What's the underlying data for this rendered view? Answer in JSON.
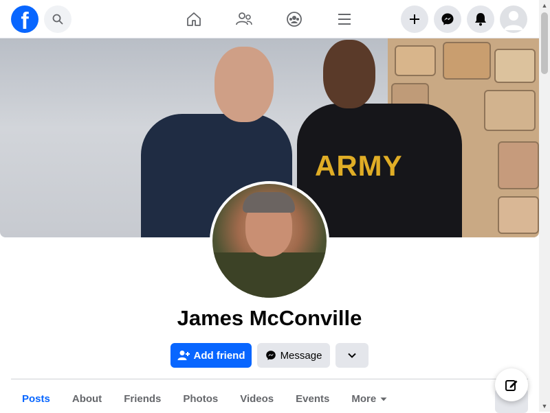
{
  "nav": {
    "logo_letter": "f",
    "icons": [
      "search-icon",
      "home-icon",
      "friends-icon",
      "groups-icon",
      "menu-icon",
      "create-icon",
      "messenger-icon",
      "notifications-icon",
      "account-avatar"
    ]
  },
  "cover": {
    "shirt_text": "ARMY"
  },
  "profile": {
    "name": "James McConville"
  },
  "actions": {
    "add_friend": "Add friend",
    "message": "Message"
  },
  "tabs": [
    {
      "label": "Posts",
      "active": true
    },
    {
      "label": "About"
    },
    {
      "label": "Friends"
    },
    {
      "label": "Photos"
    },
    {
      "label": "Videos"
    },
    {
      "label": "Events"
    },
    {
      "label": "More"
    }
  ],
  "colors": {
    "accent": "#0866ff",
    "button_gray": "#e4e6eb",
    "text_secondary": "#65676b"
  }
}
